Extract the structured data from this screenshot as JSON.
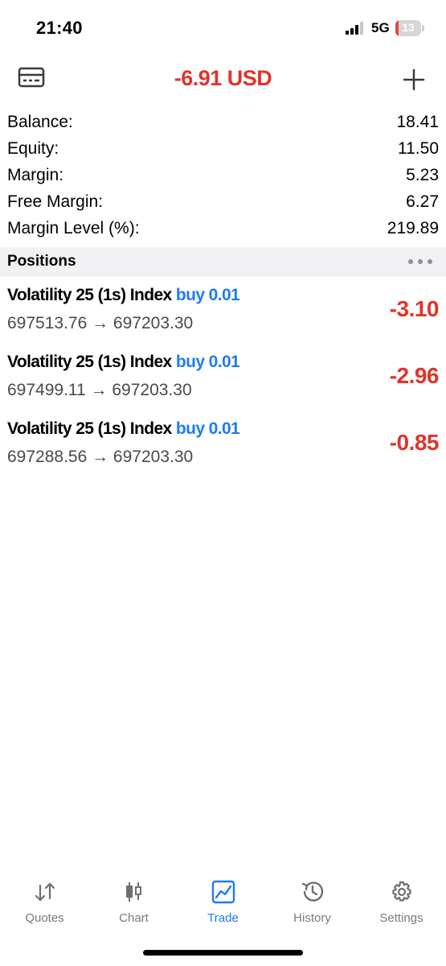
{
  "status_bar": {
    "time": "21:40",
    "network": "5G",
    "battery": "13"
  },
  "header": {
    "title": "-6.91 USD"
  },
  "account": {
    "rows": [
      {
        "label": "Balance:",
        "value": "18.41"
      },
      {
        "label": "Equity:",
        "value": "11.50"
      },
      {
        "label": "Margin:",
        "value": "5.23"
      },
      {
        "label": "Free Margin:",
        "value": "6.27"
      },
      {
        "label": "Margin Level (%):",
        "value": "219.89"
      }
    ]
  },
  "positions": {
    "title": "Positions",
    "items": [
      {
        "symbol": "Volatility 25 (1s) Index",
        "side": "buy 0.01",
        "prices": "697513.76 → 697203.30",
        "profit": "-3.10"
      },
      {
        "symbol": "Volatility 25 (1s) Index",
        "side": "buy 0.01",
        "prices": "697499.11 → 697203.30",
        "profit": "-2.96"
      },
      {
        "symbol": "Volatility 25 (1s) Index",
        "side": "buy 0.01",
        "prices": "697288.56 → 697203.30",
        "profit": "-0.85"
      }
    ]
  },
  "tabbar": {
    "tabs": [
      {
        "label": "Quotes",
        "icon": "quotes-arrows-icon"
      },
      {
        "label": "Chart",
        "icon": "candlestick-icon"
      },
      {
        "label": "Trade",
        "icon": "trade-chart-icon",
        "active": true
      },
      {
        "label": "History",
        "icon": "history-clock-icon"
      },
      {
        "label": "Settings",
        "icon": "gear-icon"
      }
    ]
  },
  "colors": {
    "accent": "#1e7cf0",
    "loss": "#e0342b",
    "section_bg": "#f2f2f4"
  }
}
